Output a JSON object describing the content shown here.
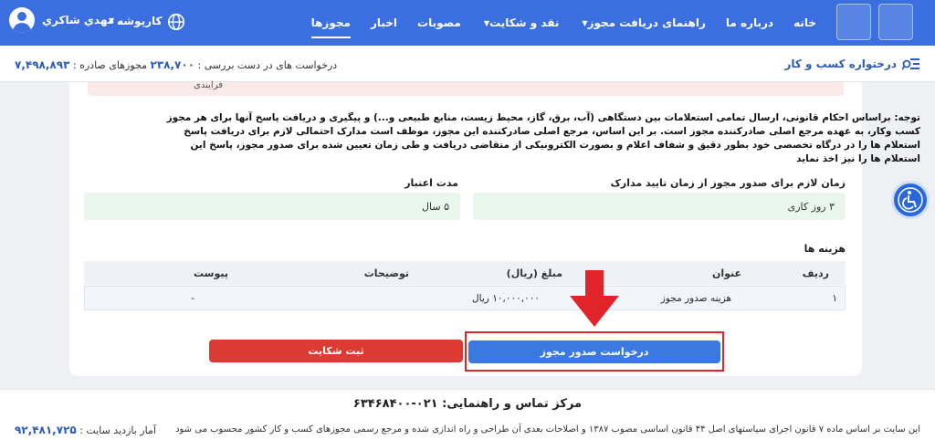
{
  "header": {
    "nav": [
      {
        "label": "خانه",
        "caret": false,
        "active": false
      },
      {
        "label": "درباره ما",
        "caret": false,
        "active": false
      },
      {
        "label": "راهنمای دریافت مجوز",
        "caret": true,
        "active": false
      },
      {
        "label": "نقد و شکایت",
        "caret": true,
        "active": false
      },
      {
        "label": "مصوبات",
        "caret": false,
        "active": false
      },
      {
        "label": "اخبار",
        "caret": false,
        "active": false
      },
      {
        "label": "مجوزها",
        "caret": false,
        "active": true
      }
    ],
    "announcements_label": "کارپوشه",
    "user_name": "مهدي شاكري"
  },
  "subbar": {
    "dashboard_label": "درختواره کسب و کار",
    "issued_label": "مجوزهای صادره :",
    "issued_count": "۷,۴۹۸,۸۹۳",
    "pending_label": "درخواست های در دست بررسی :",
    "pending_count": "۲۳۸,۷۰۰"
  },
  "card": {
    "strip_text": "فرایندی",
    "notice": "توجه: براساس احکام قانونی، ارسال تمامی استعلامات بین دستگاهی (آب، برق، گاز، محیط زیست، منابع طبیعی و...) و پیگیری و دریافت پاسخ آنها برای هر مجوز کسب وکار، به عهده مرجع اصلی صادرکننده مجوز است. بر این اساس، مرجع اصلی صادرکننده این مجوز، موظف است مدارک احتمالی لازم برای دریافت پاسخ استعلام ها را در درگاه تخصصی خود بطور دقیق و شفاف اعلام و بصورت الکترونیکی از متقاضی دریافت و طی زمان تعیین شده برای صدور مجوز، پاسخ این استعلام ها را نیز اخذ نماید",
    "time_label": "زمان لازم برای صدور مجوز از زمان تایید مدارک",
    "time_value": "۳ روز کاری",
    "validity_label": "مدت اعتبار",
    "validity_value": "۵ سال",
    "fees_label": "هزینه ها",
    "table": {
      "headers": {
        "index": "ردیف",
        "title": "عنوان",
        "amount": "مبلغ (ریال)",
        "desc": "توضیحات",
        "attachment": "پیوست"
      },
      "rows": [
        {
          "index": "۱",
          "title": "هزینه صدور مجوز",
          "amount": "۱۰,۰۰۰,۰۰۰ ریال",
          "desc": "",
          "attachment": "-"
        }
      ]
    },
    "request_button": "درخواست صدور مجوز",
    "complaint_button": "ثبت شکایت"
  },
  "footer": {
    "contact": "مرکز تماس و راهنمایی: ۰۲۱-۶۳۴۶۸۴۰۰",
    "law_text": "این سایت بر اساس ماده ۷ قانون اجرای سیاستهای اصل ۴۴ قانون اساسی مصوب ۱۳۸۷ و اصلاحات بعدی آن طراحی و راه اندازی شده و مرجع رسمی مجوزهای کسب و کار کشور محسوب می شود",
    "visits_label": "آمار بازدید سایت :",
    "visits_count": "۹۲,۴۸۱,۷۲۵"
  },
  "colors": {
    "primary": "#3b6fe0",
    "danger": "#dc3b34",
    "highlight": "#e0242a"
  }
}
